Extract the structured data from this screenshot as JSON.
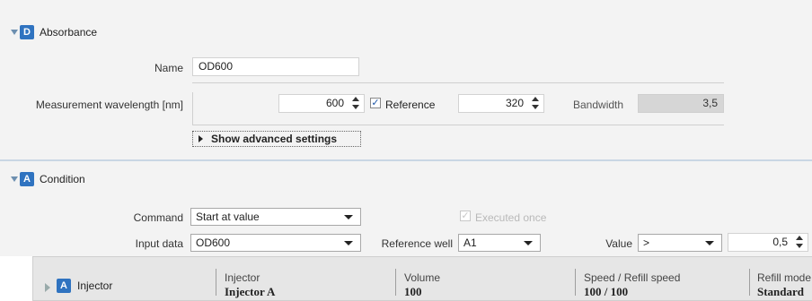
{
  "absorbance": {
    "badge": "D",
    "title": "Absorbance",
    "name_label": "Name",
    "name_value": "OD600",
    "wavelength_label": "Measurement wavelength [nm]",
    "wavelength_value": "600",
    "reference_checked": true,
    "reference_label": "Reference",
    "reference_value": "320",
    "bandwidth_label": "Bandwidth",
    "bandwidth_value": "3,5",
    "advanced_label": "Show advanced settings"
  },
  "condition": {
    "badge": "A",
    "title": "Condition",
    "command_label": "Command",
    "command_value": "Start at value",
    "executed_once_label": "Executed once",
    "executed_once_checked": true,
    "input_data_label": "Input data",
    "input_data_value": "OD600",
    "reference_well_label": "Reference well",
    "reference_well_value": "A1",
    "value_label": "Value",
    "value_operator": ">",
    "value_number": "0,5"
  },
  "injector": {
    "badge": "A",
    "title": "Injector",
    "columns": [
      {
        "label": "Injector",
        "value": "Injector A"
      },
      {
        "label": "Volume",
        "value": "100"
      },
      {
        "label": "Speed / Refill speed",
        "value": "100 / 100"
      },
      {
        "label": "Refill mode",
        "value": "Standard"
      }
    ]
  },
  "colors": {
    "badge_blue": "#2f73c0",
    "panel_bg": "#f3f3f3",
    "injector_bg": "#e6e6e6",
    "separator": "#c9d6e4"
  }
}
